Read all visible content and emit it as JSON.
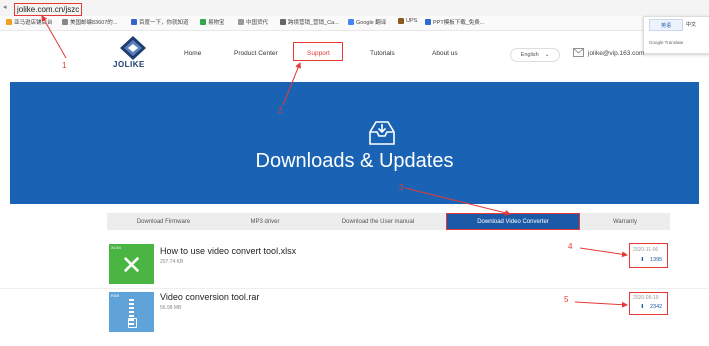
{
  "browser": {
    "url": "jolike.com.cn/jszc",
    "bookmarks": [
      {
        "label": "亚马逊店铺后台",
        "color": "#f0a020"
      },
      {
        "label": "美国邮编83607的...",
        "color": "#888888"
      },
      {
        "label": "百度一下，你就知道",
        "color": "#3366cc"
      },
      {
        "label": "易物宝",
        "color": "#2fa84f"
      },
      {
        "label": "中国货代",
        "color": "#999999"
      },
      {
        "label": "跨境营销_营销_Ca...",
        "color": "#666666"
      },
      {
        "label": "Google 翻译",
        "color": "#4285f4"
      },
      {
        "label": "UPS",
        "color": "#8b5a1e"
      },
      {
        "label": "PPT模板下载_免费...",
        "color": "#2b6cd1"
      }
    ],
    "translate_popup": {
      "button": "英语",
      "button2": "中文",
      "footer": "Google Translate"
    }
  },
  "header": {
    "logo_text": "JOLIKE",
    "nav": [
      {
        "label": "Home"
      },
      {
        "label": "Product Center"
      },
      {
        "label": "Support"
      },
      {
        "label": "Tutorials"
      },
      {
        "label": "About us"
      }
    ],
    "language": "English",
    "email": "jolike@vip.163.com"
  },
  "banner": {
    "title": "Downloads & Updates",
    "background": "#1a63b4"
  },
  "tabs": [
    {
      "label": "Download Firmware",
      "active": false
    },
    {
      "label": "MP3 driver",
      "active": false
    },
    {
      "label": "Download the User manual",
      "active": false
    },
    {
      "label": "Download Video Converter",
      "active": true
    },
    {
      "label": "Warranty",
      "active": false
    }
  ],
  "downloads": [
    {
      "title": "How to use video convert tool.xlsx",
      "size": "207.74 KB",
      "date": "2020-11-06",
      "count": "1395",
      "icon": "excel-icon",
      "badge": "XLSX"
    },
    {
      "title": "Video conversion tool.rar",
      "size": "56.98 MB",
      "date": "2020-05-19",
      "count": "2342",
      "icon": "zip-icon",
      "badge": "RAR"
    }
  ],
  "annotations": [
    "1",
    "2",
    "3",
    "4",
    "5"
  ],
  "colors": {
    "accent": "#e53935",
    "brand": "#1c5aa8"
  }
}
